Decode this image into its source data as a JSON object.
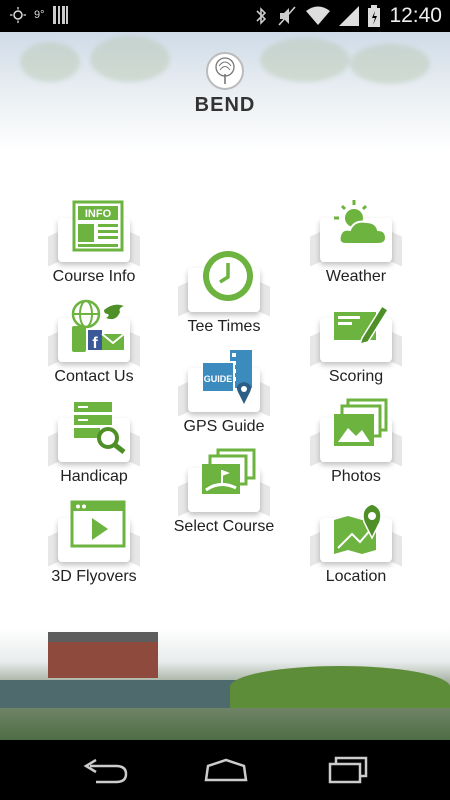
{
  "status_bar": {
    "temperature": "9°",
    "time": "12:40"
  },
  "header": {
    "brand": "BEND"
  },
  "colors": {
    "accent": "#6db33f",
    "accent_dark": "#4f8f28"
  },
  "menu": {
    "course_info": "Course Info",
    "weather": "Weather",
    "tee_times": "Tee Times",
    "contact_us": "Contact Us",
    "scoring": "Scoring",
    "gps_guide": "GPS Guide",
    "handicap": "Handicap",
    "photos": "Photos",
    "select_course": "Select Course",
    "flyovers": "3D Flyovers",
    "location": "Location"
  },
  "icon_text": {
    "info": "INFO",
    "guide": "GUIDE"
  },
  "icons": {
    "course_info": "newspaper-icon",
    "weather": "cloud-sun-icon",
    "tee_times": "clock-icon",
    "contact_us": "social-contact-icon",
    "scoring": "scorecard-pencil-icon",
    "gps_guide": "gps-guide-icon",
    "handicap": "server-search-icon",
    "photos": "photos-icon",
    "select_course": "course-select-icon",
    "flyovers": "video-play-icon",
    "location": "map-pin-icon"
  },
  "nav_bar": {
    "back": "back-icon",
    "home": "home-icon",
    "recents": "recents-icon"
  }
}
